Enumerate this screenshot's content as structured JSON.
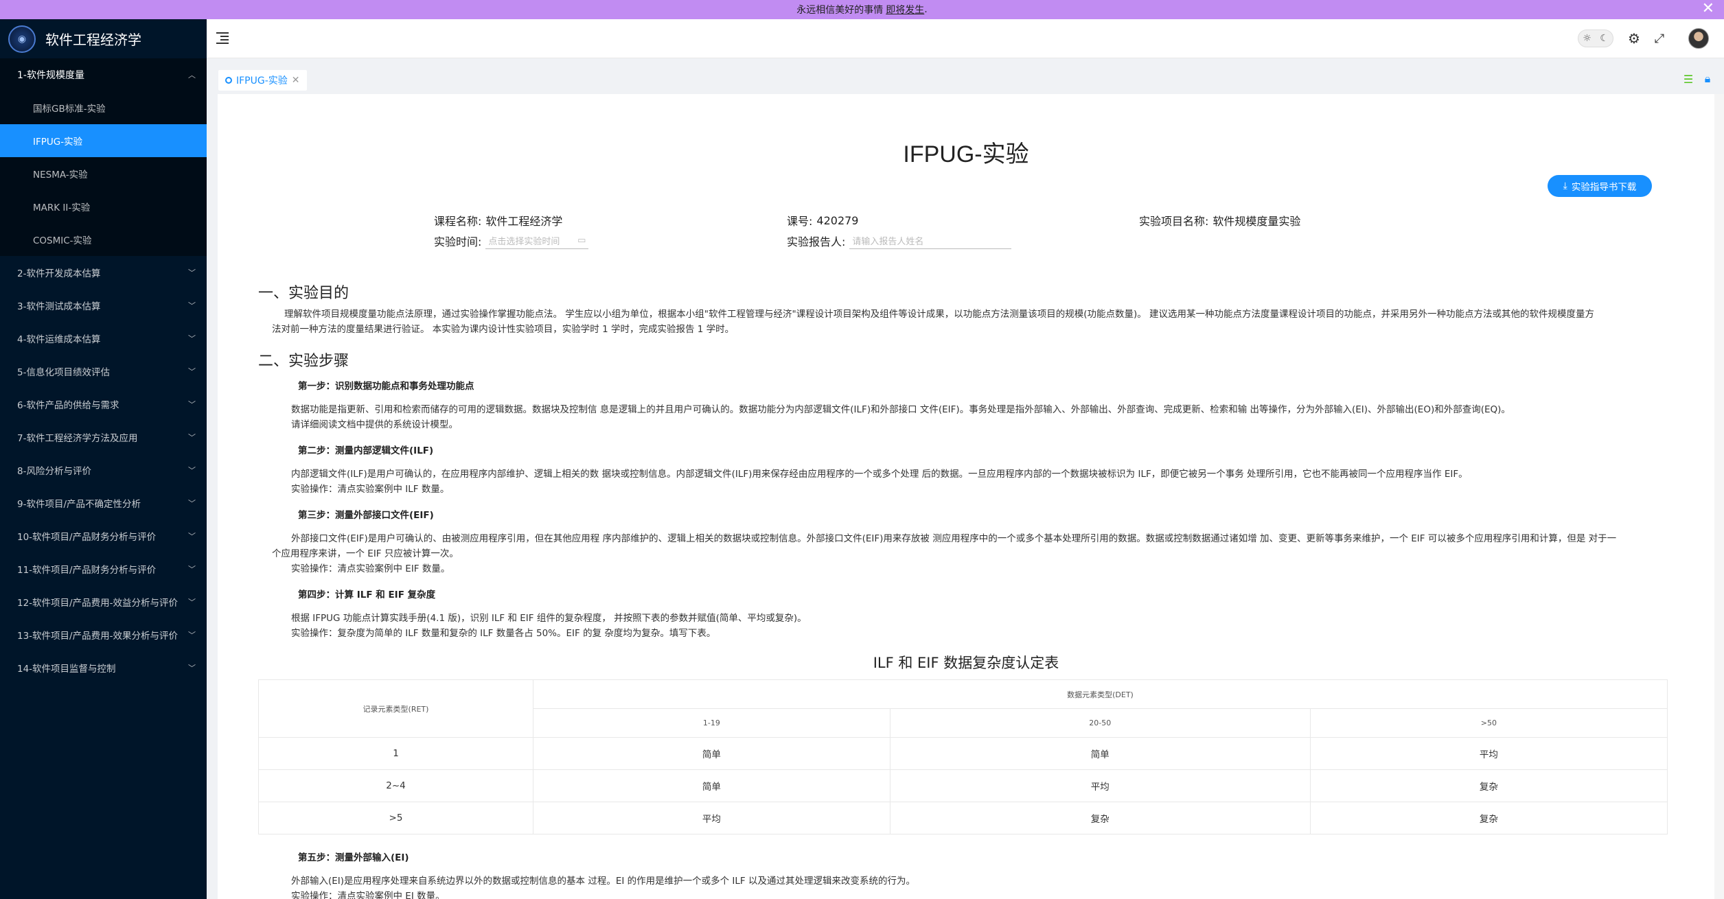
{
  "banner": {
    "text": "永远相信美好的事情",
    "link": "即将发生",
    "suffix": "."
  },
  "sidebar": {
    "app_title": "软件工程经济学",
    "open_menu": {
      "label": "1-软件规模度量",
      "items": [
        "国标GB标准-实验",
        "IFPUG-实验",
        "NESMA-实验",
        "MARK II-实验",
        "COSMIC-实验"
      ],
      "active_index": 1
    },
    "menus": [
      "2-软件开发成本估算",
      "3-软件测试成本估算",
      "4-软件运维成本估算",
      "5-信息化项目绩效评估",
      "6-软件产品的供给与需求",
      "7-软件工程经济学方法及应用",
      "8-风险分析与评价",
      "9-软件项目/产品不确定性分析",
      "10-软件项目/产品财务分析与评价",
      "11-软件项目/产品财务分析与评价",
      "12-软件项目/产品费用-效益分析与评价",
      "13-软件项目/产品费用-效果分析与评价",
      "14-软件项目监督与控制"
    ]
  },
  "tabs": {
    "active_label": "IFPUG-实验"
  },
  "page": {
    "title": "IFPUG-实验",
    "download_label": "实验指导书下载",
    "course_label": "课程名称:",
    "course_value": "软件工程经济学",
    "course_no_label": "课号:",
    "course_no_value": "420279",
    "project_label": "实验项目名称:",
    "project_value": "软件规模度量实验",
    "time_label": "实验时间:",
    "time_placeholder": "点击选择实验时间",
    "reporter_label": "实验报告人:",
    "reporter_placeholder": "请输入报告人姓名",
    "section1_title": "一、实验目的",
    "section1_text_1": "理解软件项目规模度量功能点法原理，通过实验操作掌握功能点法。 学生应以小组为单位，根据本小组\"软件工程管理与经济\"课程设计项目架构及组件等设计成果，以功能点方法测量该项目的规模(功能点数量)。 建议选用某一种功能点方法度量课程设计项目的功能点，并采用另外一种功能点方法或其他的软件规模度量方",
    "section1_text_2": "法对前一种方法的度量结果进行验证。 本实验为课内设计性实验项目，实验学时 1 学时，完成实验报告 1 学时。",
    "section2_title": "二、实验步骤",
    "step1_title": "第一步：识别数据功能点和事务处理功能点",
    "step1_text_1": "数据功能是指更新、引用和检索而储存的可用的逻辑数据。数据块及控制信 息是逻辑上的并且用户可确认的。数据功能分为内部逻辑文件(ILF)和外部接口 文件(EIF)。事务处理是指外部输入、外部输出、外部查询、完成更新、检索和输 出等操作，分为外部输入(EI)、外部输出(EO)和外部查询(EQ)。",
    "step1_text_2": "请详细阅读文档中提供的系统设计模型。",
    "step2_title": "第二步：测量内部逻辑文件(ILF)",
    "step2_text_1": "内部逻辑文件(ILF)是用户可确认的，在应用程序内部维护、逻辑上相关的数 据块或控制信息。内部逻辑文件(ILF)用来保存经由应用程序的一个或多个处理 后的数据。一旦应用程序内部的一个数据块被标识为 ILF，即便它被另一个事务 处理所引用，它也不能再被同一个应用程序当作 EIF。",
    "step2_text_2": "实验操作：清点实验案例中 ILF 数量。",
    "step3_title": "第三步：测量外部接口文件(EIF)",
    "step3_text_1": "外部接口文件(EIF)是用户可确认的、由被测应用程序引用，但在其他应用程 序内部维护的、逻辑上相关的数据块或控制信息。外部接口文件(EIF)用来存放被 测应用程序中的一个或多个基本处理所引用的数据。数据或控制数据通过诸如增 加、变更、更新等事务来维护，一个 EIF 可以被多个应用程序引用和计算，但是 对于一",
    "step3_text_2": "个应用程序来讲，一个 EIF 只应被计算一次。",
    "step3_text_3": "实验操作：清点实验案例中 EIF 数量。",
    "step4_title": "第四步：计算 ILF 和 EIF 复杂度",
    "step4_text_1": "根据 IFPUG 功能点计算实践手册(4.1 版)，识别 ILF 和 EIF 组件的复杂程度， 并按照下表的参数并赋值(简单、平均或复杂)。",
    "step4_text_2": "实验操作：复杂度为简单的 ILF 数量和复杂的 ILF 数量各占 50%。EIF 的复 杂度均为复杂。填写下表。",
    "table_title": "ILF 和 EIF 数据复杂度认定表",
    "table": {
      "ret_header": "记录元素类型(RET)",
      "det_header": "数据元素类型(DET)",
      "det_cols": [
        "1-19",
        "20-50",
        ">50"
      ],
      "rows": [
        {
          "ret": "1",
          "cells": [
            "简单",
            "简单",
            "平均"
          ]
        },
        {
          "ret": "2~4",
          "cells": [
            "简单",
            "平均",
            "复杂"
          ]
        },
        {
          "ret": ">5",
          "cells": [
            "平均",
            "复杂",
            "复杂"
          ]
        }
      ]
    },
    "step5_title": "第五步：测量外部输入(EI)",
    "step5_text_1": "外部输入(EI)是应用程序处理来自系统边界以外的数据或控制信息的基本 过程。EI 的作用是维护一个或多个 ILF 以及通过其处理逻辑来改变系统的行为。",
    "step5_text_2": "实验操作：清点实验案例中 EI 数量。"
  }
}
